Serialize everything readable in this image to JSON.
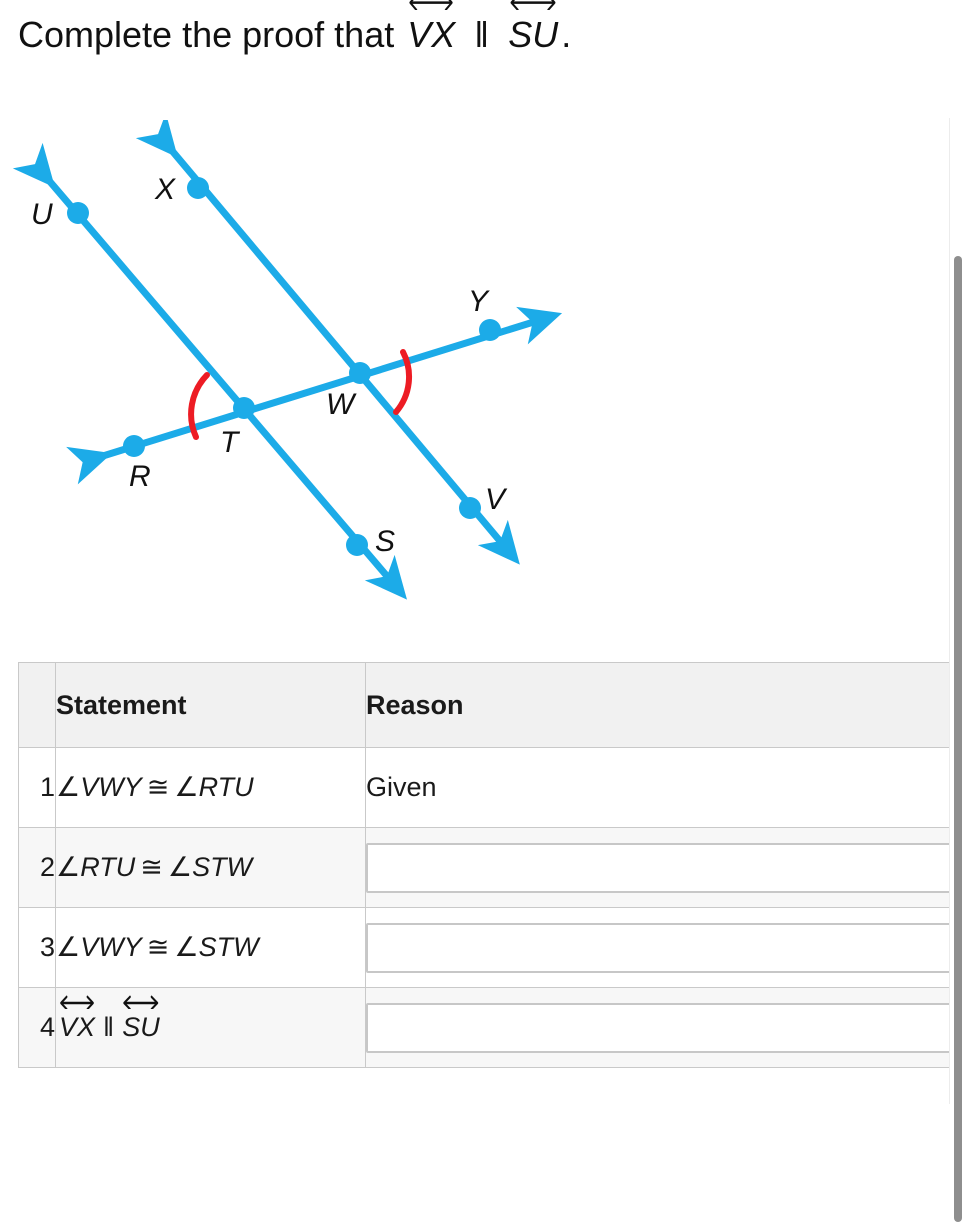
{
  "prompt": {
    "lead": "Complete the proof that",
    "line1": "VX",
    "parallel_symbol": "‖",
    "line2": "SU",
    "period": "."
  },
  "figure": {
    "line_color": "#1CABE8",
    "angle_arc_color": "#ED1C24",
    "point_labels": [
      "U",
      "X",
      "Y",
      "W",
      "T",
      "R",
      "S",
      "V"
    ],
    "points": {
      "U": "U",
      "X": "X",
      "Y": "Y",
      "W": "W",
      "T": "T",
      "R": "R",
      "S": "S",
      "V": "V"
    },
    "marked_angles": [
      "RTU",
      "VWY"
    ]
  },
  "table": {
    "headers": {
      "num": "",
      "statement": "Statement",
      "reason": "Reason"
    },
    "rows": [
      {
        "num": "1",
        "statement_prefix": "∠",
        "statement_left": "VWY",
        "relation": "≅",
        "statement_right": "RTU",
        "reason_type": "text",
        "reason_value": "Given",
        "reason_placeholder": ""
      },
      {
        "num": "2",
        "statement_prefix": "∠",
        "statement_left": "RTU",
        "relation": "≅",
        "statement_right": "STW",
        "reason_type": "input",
        "reason_value": "",
        "reason_placeholder": ""
      },
      {
        "num": "3",
        "statement_prefix": "∠",
        "statement_left": "VWY",
        "relation": "≅",
        "statement_right": "STW",
        "reason_type": "input",
        "reason_value": "",
        "reason_placeholder": ""
      },
      {
        "num": "4",
        "statement_prefix": "",
        "statement_left": "VX",
        "relation": "‖",
        "statement_right": "SU",
        "reason_type": "input",
        "reason_value": "",
        "reason_placeholder": ""
      }
    ]
  },
  "scrollbar": {
    "orientation": "vertical",
    "thumb_color": "#8e8e8e"
  }
}
